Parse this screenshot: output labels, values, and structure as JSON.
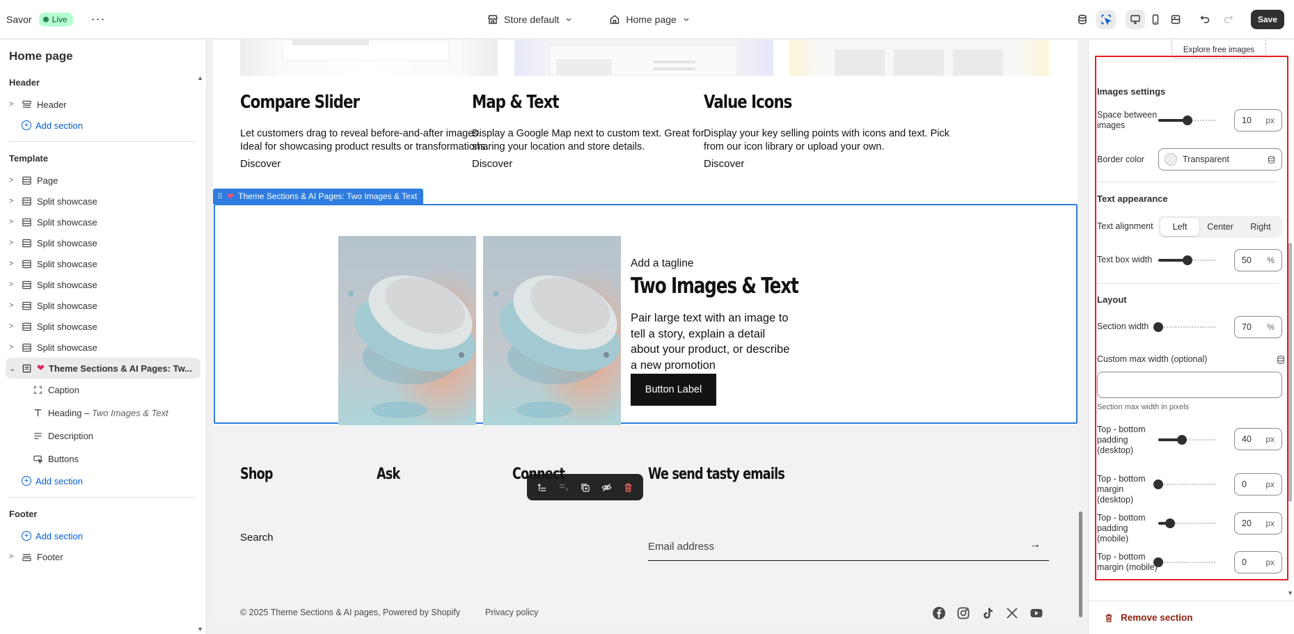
{
  "topbar": {
    "app_name": "Savor",
    "live_label": "Live",
    "store_select": "Store default",
    "page_select": "Home page",
    "save_label": "Save"
  },
  "sidebar": {
    "title": "Home page",
    "header_group": "Header",
    "header_item": "Header",
    "add_section": "Add section",
    "template_group": "Template",
    "template_items": [
      "Page",
      "Split showcase",
      "Split showcase",
      "Split showcase",
      "Split showcase",
      "Split showcase",
      "Split showcase",
      "Split showcase",
      "Split showcase"
    ],
    "selected_section": "Theme Sections & AI Pages: Tw...",
    "blocks": {
      "caption": "Caption",
      "heading_prefix": "Heading –",
      "heading_detail": "Two Images & Text",
      "description": "Description",
      "buttons": "Buttons"
    },
    "footer_group": "Footer",
    "footer_item": "Footer"
  },
  "preview": {
    "features": [
      {
        "title": "Compare Slider",
        "desc": "Let customers drag to reveal before-and-after images. Ideal for showcasing product results or transformations.",
        "link": "Discover"
      },
      {
        "title": "Map & Text",
        "desc": "Display a Google Map next to custom text. Great for sharing your location and store details.",
        "link": "Discover"
      },
      {
        "title": "Value Icons",
        "desc": "Display your key selling points with icons and text. Pick from our icon library or upload your own.",
        "link": "Discover"
      }
    ],
    "selection_tag": "Theme Sections & AI Pages: Two Images & Text",
    "tagline": "Add a tagline",
    "heading": "Two Images & Text",
    "description": "Pair large text with an image to tell a story, explain a detail about your product, or describe a new promotion",
    "button_label": "Button Label",
    "footer": {
      "shop": "Shop",
      "ask": "Ask",
      "connect": "Connect",
      "newsletter": "We send tasty emails",
      "search_link": "Search",
      "email_placeholder": "Email address",
      "copyright": "© 2025 Theme Sections & AI pages, Powered by Shopify",
      "privacy": "Privacy policy"
    }
  },
  "panel": {
    "explore_images": "Explore free images",
    "images_settings": "Images settings",
    "space_between_label": "Space between images",
    "space_between": {
      "value": "10",
      "unit": "px",
      "level": 0.5
    },
    "border_color_label": "Border color",
    "border_color_value": "Transparent",
    "text_appearance": "Text appearance",
    "text_alignment_label": "Text alignment",
    "alignment_options": [
      "Left",
      "Center",
      "Right"
    ],
    "alignment_selected": "Left",
    "text_box_width_label": "Text box width",
    "text_box_width": {
      "value": "50",
      "unit": "%",
      "level": 0.5
    },
    "layout": "Layout",
    "section_width_label": "Section width",
    "section_width": {
      "value": "70",
      "unit": "%",
      "level": 0.0
    },
    "custom_max_width_label": "Custom max width (optional)",
    "custom_max_width_value": "",
    "section_max_help": "Section max width in pixels",
    "pad_desktop_label": "Top - bottom padding (desktop)",
    "pad_desktop": {
      "value": "40",
      "unit": "px",
      "level": 0.4
    },
    "margin_desktop_label": "Top - bottom margin (desktop)",
    "margin_desktop": {
      "value": "0",
      "unit": "px",
      "level": 0.0
    },
    "pad_mobile_label": "Top - bottom padding (mobile)",
    "pad_mobile": {
      "value": "20",
      "unit": "px",
      "level": 0.2
    },
    "margin_mobile_label": "Top - bottom margin (mobile)",
    "margin_mobile": {
      "value": "0",
      "unit": "px",
      "level": 0.0
    },
    "remove_section": "Remove section"
  },
  "colors": {
    "accent_blue": "#2e7ce0",
    "live_green": "#b4fed2",
    "annotation_red": "#e51c23",
    "remove_red": "#8e1f0b"
  },
  "icons": [
    "store-icon",
    "home-icon",
    "chevron-down-icon",
    "database-icon",
    "inspector-icon",
    "desktop-icon",
    "mobile-icon",
    "fullwidth-icon",
    "undo-icon",
    "redo-icon",
    "section-icon",
    "caption-icon",
    "heading-icon",
    "description-icon",
    "buttons-icon",
    "heart-icon",
    "trash-icon",
    "arrow-right-icon",
    "facebook-icon",
    "instagram-icon",
    "tiktok-icon",
    "x-icon",
    "youtube-icon"
  ]
}
